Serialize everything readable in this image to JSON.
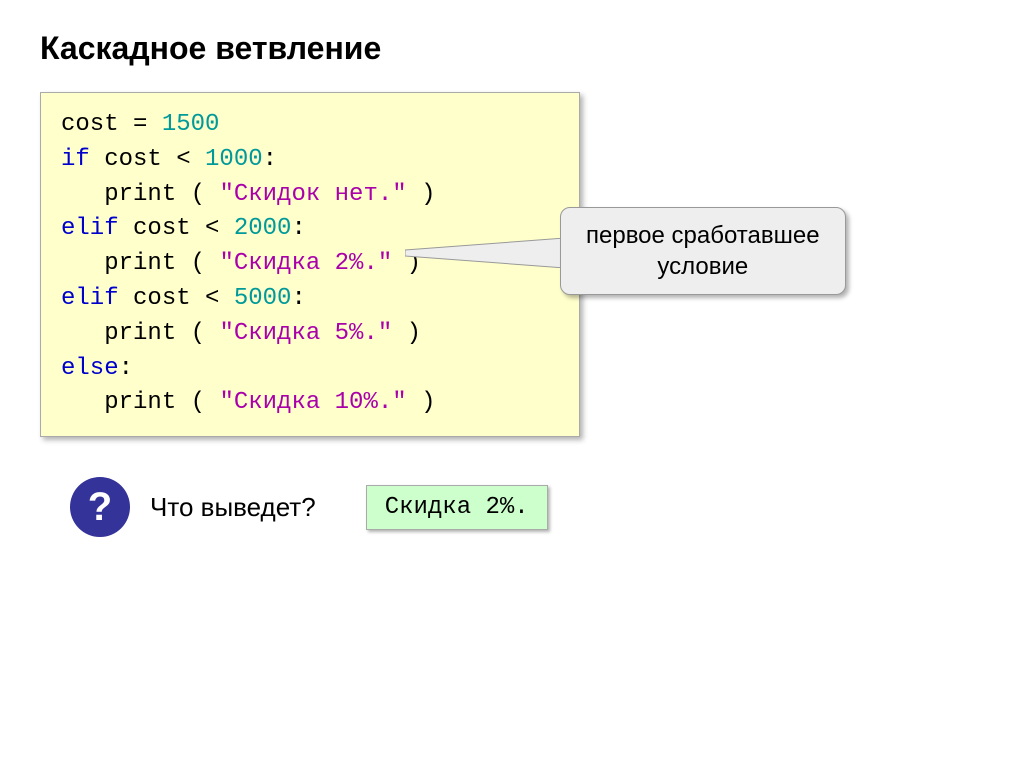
{
  "title": "Каскадное ветвление",
  "code": {
    "l1a": "cost = ",
    "l1b": "1500",
    "l2a": "if",
    "l2b": " cost < ",
    "l2c": "1000",
    "l2d": ":",
    "l3a": "   print ( ",
    "l3b": "\"Скидок нет.\"",
    "l3c": " )",
    "l4a": "elif",
    "l4b": " cost < ",
    "l4c": "2000",
    "l4d": ":",
    "l5a": "   print ( ",
    "l5b": "\"Скидка 2%.\"",
    "l5c": " )",
    "l6a": "elif",
    "l6b": " cost < ",
    "l6c": "5000",
    "l6d": ":",
    "l7a": "   print ( ",
    "l7b": "\"Скидка 5%.\"",
    "l7c": " )",
    "l8a": "else",
    "l8b": ":",
    "l9a": "   print ( ",
    "l9b": "\"Скидка 10%.\"",
    "l9c": " )"
  },
  "callout": {
    "line1": "первое сработавшее",
    "line2": "условие"
  },
  "question": {
    "badge": "?",
    "text": "Что выведет?",
    "answer": "Скидка 2%."
  }
}
